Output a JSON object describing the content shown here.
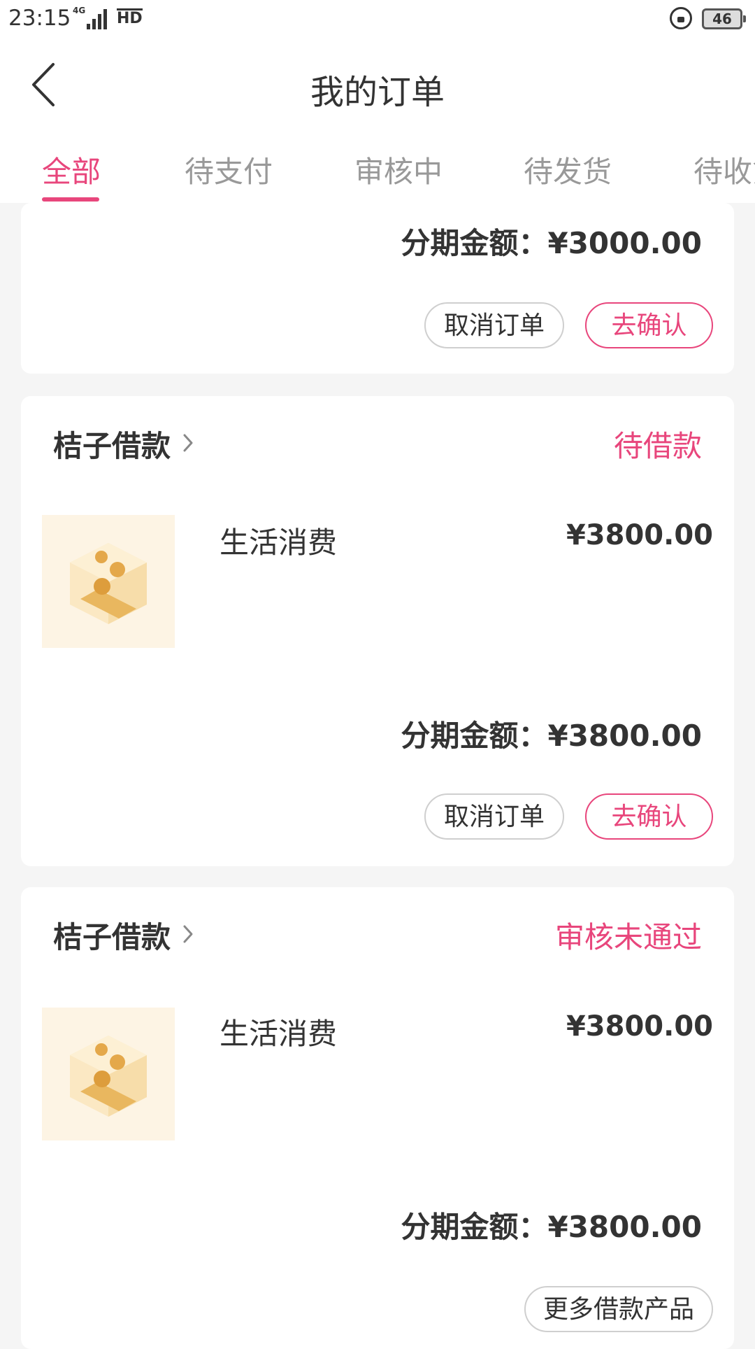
{
  "status_bar": {
    "time": "23:15",
    "network": "4G",
    "hd": "HD",
    "battery": "46"
  },
  "header": {
    "title": "我的订单"
  },
  "tabs": [
    {
      "label": "全部"
    },
    {
      "label": "待支付"
    },
    {
      "label": "审核中"
    },
    {
      "label": "待发货"
    },
    {
      "label": "待收货"
    }
  ],
  "orders": [
    {
      "installment": "分期金额：¥3000.00",
      "buttons": {
        "cancel": "取消订单",
        "confirm": "去确认"
      }
    },
    {
      "merchant": "桔子借款",
      "status": "待借款",
      "product_name": "生活消费",
      "price": "¥3800.00",
      "installment": "分期金额：¥3800.00",
      "buttons": {
        "cancel": "取消订单",
        "confirm": "去确认"
      }
    },
    {
      "merchant": "桔子借款",
      "status": "审核未通过",
      "product_name": "生活消费",
      "price": "¥3800.00",
      "installment": "分期金额：¥3800.00",
      "buttons": {
        "more": "更多借款产品"
      }
    }
  ],
  "colors": {
    "accent": "#e8467c",
    "text": "#333333",
    "muted": "#999999",
    "background": "#f5f5f5"
  }
}
